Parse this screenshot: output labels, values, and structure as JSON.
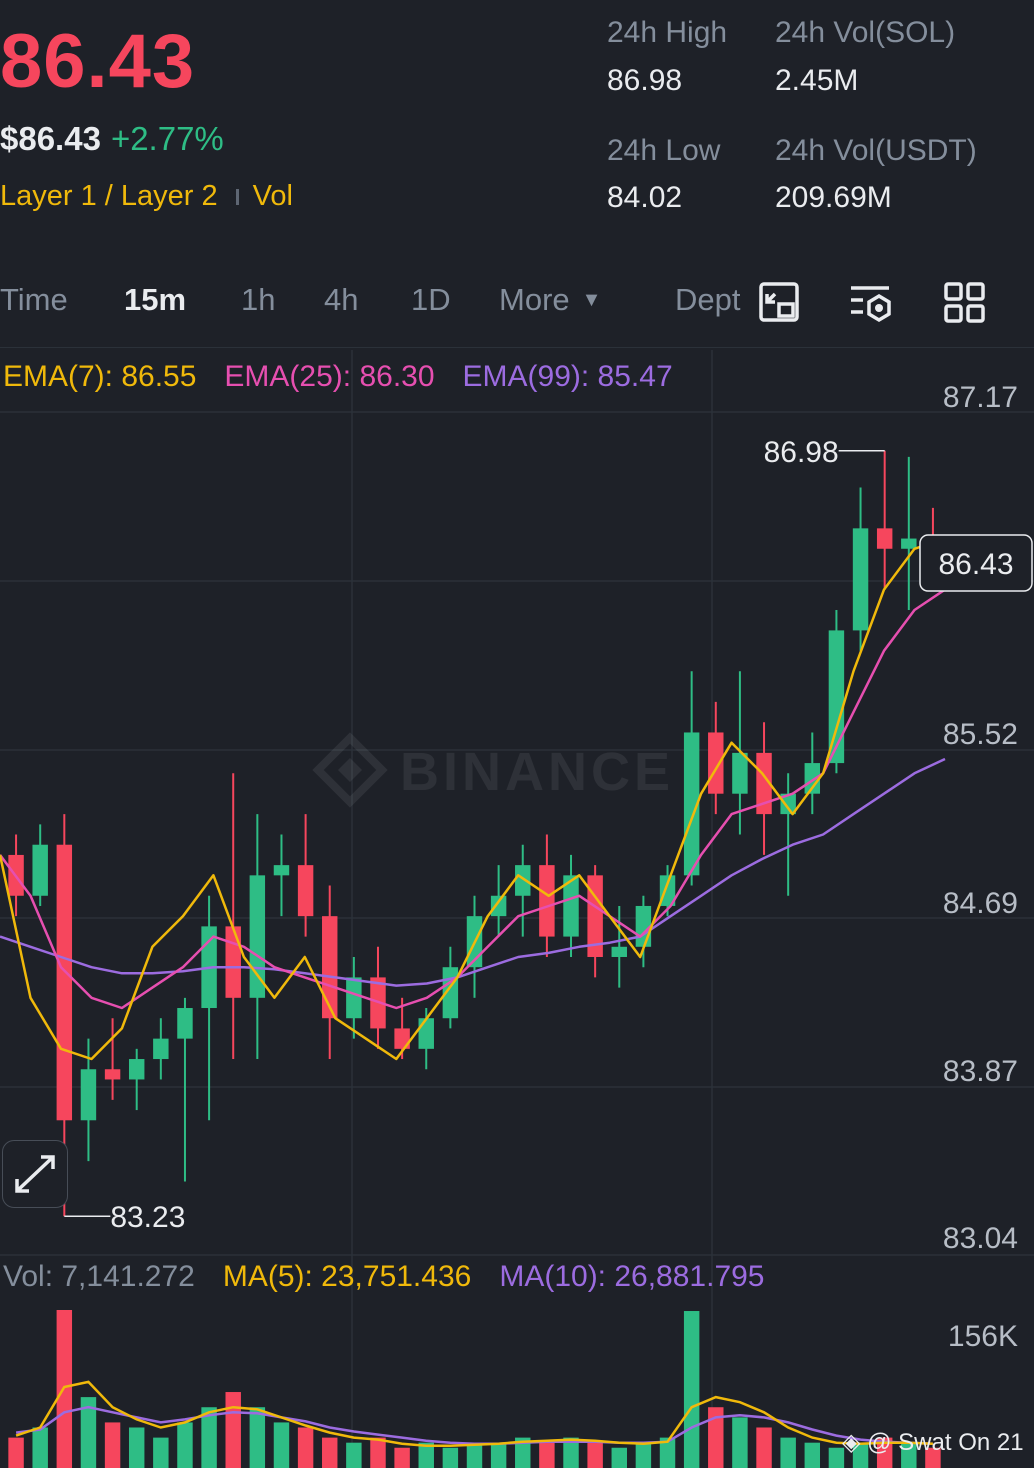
{
  "header": {
    "price": "86.43",
    "price_usd": "$86.43",
    "change": "+2.77%",
    "tag": "Layer 1 / Layer 2",
    "vol_tag": "Vol",
    "high_label": "24h High",
    "high_value": "86.98",
    "low_label": "24h Low",
    "low_value": "84.02",
    "vol_sol_label": "24h Vol(SOL)",
    "vol_sol_value": "2.45M",
    "vol_usdt_label": "24h Vol(USDT)",
    "vol_usdt_value": "209.69M"
  },
  "tabs": {
    "time": "Time",
    "m15": "15m",
    "h1": "1h",
    "h4": "4h",
    "d1": "1D",
    "more": "More",
    "depth": "Dept"
  },
  "legend": {
    "ema7": "EMA(7): 86.55",
    "ema25": "EMA(25): 86.30",
    "ema99": "EMA(99): 85.47",
    "vol": "Vol: 7,141.272",
    "ma5": "MA(5): 23,751.436",
    "ma10": "MA(10): 26,881.795"
  },
  "watermark": "BINANCE",
  "credit": "@ Swat On 21",
  "colors": {
    "up": "#2ebd85",
    "down": "#f6465d",
    "ema7": "#f0b90b",
    "ema25": "#e64fb0",
    "ema99": "#9c6ce0",
    "accent": "#f0b90b"
  },
  "chart_data": {
    "type": "candlestick",
    "y_ticks": [
      "87.17",
      "85.52",
      "84.69",
      "83.87",
      "83.04"
    ],
    "ylim": [
      83.04,
      87.17
    ],
    "high_marker": "86.98",
    "low_marker": "83.23",
    "last_price_label": "86.43",
    "volume_ticks": [
      "156K"
    ],
    "ema7": [
      85.0,
      84.3,
      84.05,
      84.0,
      84.15,
      84.55,
      84.7,
      84.9,
      84.5,
      84.3,
      84.5,
      84.2,
      84.1,
      84.0,
      84.2,
      84.4,
      84.7,
      84.9,
      84.8,
      84.9,
      84.7,
      84.5,
      84.9,
      85.3,
      85.55,
      85.4,
      85.2,
      85.4,
      85.9,
      86.3,
      86.5,
      86.55
    ],
    "ema25": [
      85.0,
      84.8,
      84.45,
      84.3,
      84.25,
      84.35,
      84.45,
      84.6,
      84.55,
      84.45,
      84.4,
      84.35,
      84.3,
      84.25,
      84.3,
      84.4,
      84.55,
      84.7,
      84.75,
      84.8,
      84.7,
      84.6,
      84.75,
      85.0,
      85.2,
      85.25,
      85.3,
      85.4,
      85.7,
      86.0,
      86.2,
      86.3
    ],
    "ema99": [
      84.6,
      84.55,
      84.5,
      84.45,
      84.42,
      84.42,
      84.43,
      84.45,
      84.45,
      84.44,
      84.42,
      84.4,
      84.38,
      84.36,
      84.37,
      84.4,
      84.45,
      84.5,
      84.52,
      84.55,
      84.57,
      84.6,
      84.7,
      84.8,
      84.9,
      84.98,
      85.05,
      85.1,
      85.2,
      85.3,
      85.4,
      85.47
    ],
    "candles": [
      {
        "o": 85.0,
        "h": 85.1,
        "l": 84.7,
        "c": 84.8
      },
      {
        "o": 84.8,
        "h": 85.15,
        "l": 84.75,
        "c": 85.05
      },
      {
        "o": 85.05,
        "h": 85.2,
        "l": 83.23,
        "c": 83.7
      },
      {
        "o": 83.7,
        "h": 84.1,
        "l": 83.5,
        "c": 83.95
      },
      {
        "o": 83.95,
        "h": 84.2,
        "l": 83.8,
        "c": 83.9
      },
      {
        "o": 83.9,
        "h": 84.05,
        "l": 83.75,
        "c": 84.0
      },
      {
        "o": 84.0,
        "h": 84.2,
        "l": 83.9,
        "c": 84.1
      },
      {
        "o": 84.1,
        "h": 84.3,
        "l": 83.4,
        "c": 84.25
      },
      {
        "o": 84.25,
        "h": 84.8,
        "l": 83.7,
        "c": 84.65
      },
      {
        "o": 84.65,
        "h": 85.4,
        "l": 84.0,
        "c": 84.3
      },
      {
        "o": 84.3,
        "h": 85.2,
        "l": 84.0,
        "c": 84.9
      },
      {
        "o": 84.9,
        "h": 85.1,
        "l": 84.7,
        "c": 84.95
      },
      {
        "o": 84.95,
        "h": 85.2,
        "l": 84.6,
        "c": 84.7
      },
      {
        "o": 84.7,
        "h": 84.85,
        "l": 84.0,
        "c": 84.2
      },
      {
        "o": 84.2,
        "h": 84.5,
        "l": 84.1,
        "c": 84.4
      },
      {
        "o": 84.4,
        "h": 84.55,
        "l": 84.05,
        "c": 84.15
      },
      {
        "o": 84.15,
        "h": 84.3,
        "l": 84.0,
        "c": 84.05
      },
      {
        "o": 84.05,
        "h": 84.25,
        "l": 83.95,
        "c": 84.2
      },
      {
        "o": 84.2,
        "h": 84.55,
        "l": 84.15,
        "c": 84.45
      },
      {
        "o": 84.45,
        "h": 84.8,
        "l": 84.3,
        "c": 84.7
      },
      {
        "o": 84.7,
        "h": 84.95,
        "l": 84.6,
        "c": 84.8
      },
      {
        "o": 84.8,
        "h": 85.05,
        "l": 84.6,
        "c": 84.95
      },
      {
        "o": 84.95,
        "h": 85.1,
        "l": 84.5,
        "c": 84.6
      },
      {
        "o": 84.6,
        "h": 85.0,
        "l": 84.5,
        "c": 84.9
      },
      {
        "o": 84.9,
        "h": 84.95,
        "l": 84.4,
        "c": 84.5
      },
      {
        "o": 84.5,
        "h": 84.75,
        "l": 84.35,
        "c": 84.55
      },
      {
        "o": 84.55,
        "h": 84.8,
        "l": 84.45,
        "c": 84.75
      },
      {
        "o": 84.75,
        "h": 84.95,
        "l": 84.7,
        "c": 84.9
      },
      {
        "o": 84.9,
        "h": 85.9,
        "l": 84.85,
        "c": 85.6
      },
      {
        "o": 85.6,
        "h": 85.75,
        "l": 85.2,
        "c": 85.3
      },
      {
        "o": 85.3,
        "h": 85.9,
        "l": 85.1,
        "c": 85.5
      },
      {
        "o": 85.5,
        "h": 85.65,
        "l": 85.0,
        "c": 85.2
      },
      {
        "o": 85.2,
        "h": 85.4,
        "l": 84.8,
        "c": 85.3
      },
      {
        "o": 85.3,
        "h": 85.6,
        "l": 85.2,
        "c": 85.45
      },
      {
        "o": 85.45,
        "h": 86.2,
        "l": 85.4,
        "c": 86.1
      },
      {
        "o": 86.1,
        "h": 86.8,
        "l": 86.0,
        "c": 86.6
      },
      {
        "o": 86.6,
        "h": 86.98,
        "l": 86.3,
        "c": 86.5
      },
      {
        "o": 86.5,
        "h": 86.95,
        "l": 86.2,
        "c": 86.55
      },
      {
        "o": 86.55,
        "h": 86.7,
        "l": 86.3,
        "c": 86.43
      }
    ],
    "volume": [
      30,
      40,
      156,
      70,
      45,
      40,
      30,
      45,
      60,
      75,
      60,
      45,
      40,
      30,
      25,
      30,
      20,
      25,
      20,
      25,
      25,
      30,
      25,
      30,
      25,
      20,
      25,
      30,
      155,
      60,
      50,
      40,
      30,
      25,
      20,
      25,
      30,
      25,
      20
    ],
    "vol_ma5": [
      32,
      40,
      80,
      85,
      60,
      48,
      40,
      45,
      55,
      60,
      58,
      50,
      42,
      35,
      30,
      28,
      24,
      22,
      22,
      23,
      24,
      26,
      27,
      28,
      27,
      25,
      24,
      26,
      60,
      70,
      65,
      55,
      40,
      30,
      25,
      24,
      25,
      25,
      24
    ],
    "vol_ma10": [
      35,
      38,
      55,
      60,
      55,
      50,
      45,
      48,
      52,
      55,
      54,
      50,
      46,
      40,
      36,
      33,
      30,
      27,
      25,
      24,
      24,
      25,
      26,
      26,
      26,
      25,
      25,
      26,
      40,
      50,
      52,
      50,
      45,
      38,
      32,
      28,
      26,
      25,
      24
    ]
  }
}
